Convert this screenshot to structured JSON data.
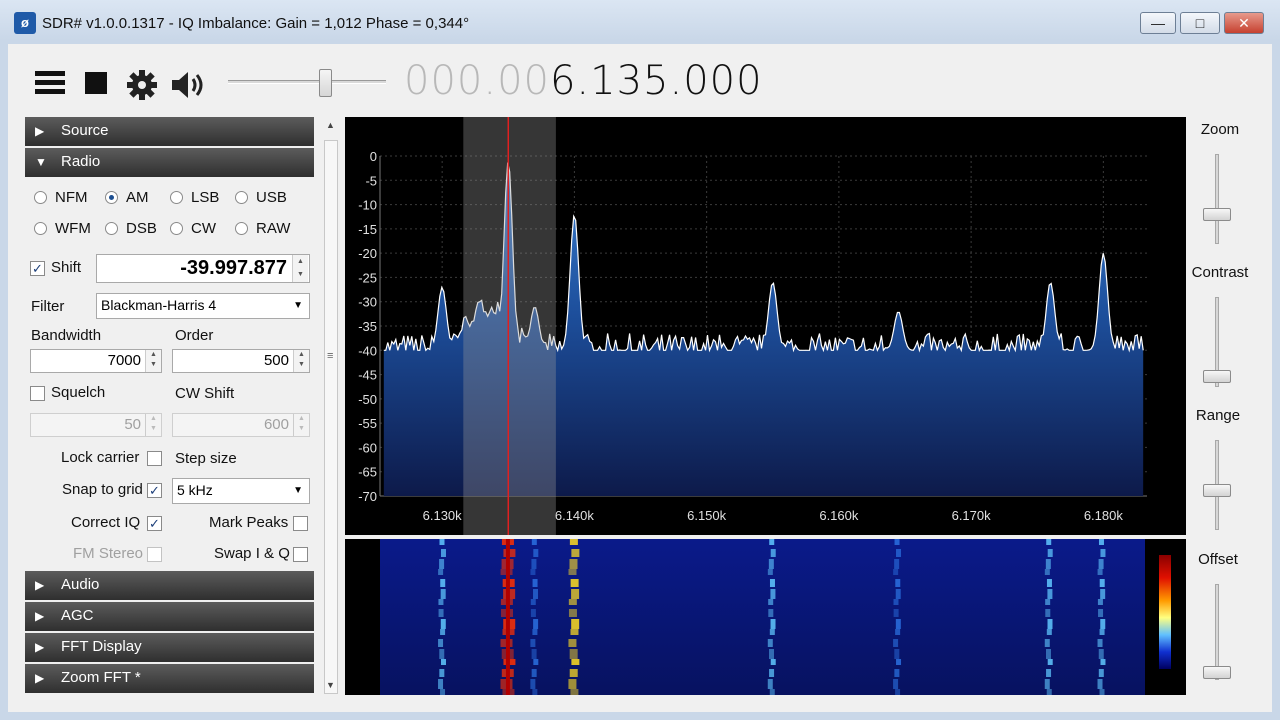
{
  "titlebar": {
    "title": "SDR# v1.0.0.1317 - IQ Imbalance: Gain = 1,012 Phase = 0,344°",
    "minimize": "—",
    "maximize": "□",
    "close": "✕"
  },
  "toolbar": {
    "menu_icon": "hamburger-menu-icon",
    "stop_icon": "stop-icon",
    "settings_icon": "gear-icon",
    "volume_icon": "speaker-icon",
    "volume_level": 0.6,
    "frequency_dim": "000.00",
    "frequency_bright": "6.135.000"
  },
  "sections": {
    "source": "Source",
    "radio": "Radio",
    "audio": "Audio",
    "agc": "AGC",
    "fft_display": "FFT Display",
    "zoom_fft": "Zoom FFT *"
  },
  "radio": {
    "modes": [
      "NFM",
      "AM",
      "LSB",
      "USB",
      "WFM",
      "DSB",
      "CW",
      "RAW"
    ],
    "selected_mode": "AM",
    "shift_label": "Shift",
    "shift_checked": true,
    "shift_value": "-39.997.877",
    "filter_label": "Filter",
    "filter_value": "Blackman-Harris 4",
    "bandwidth_label": "Bandwidth",
    "bandwidth_value": "7000",
    "order_label": "Order",
    "order_value": "500",
    "squelch_label": "Squelch",
    "squelch_value": "50",
    "cw_shift_label": "CW Shift",
    "cw_shift_value": "600",
    "lock_carrier": "Lock carrier",
    "step_size": "Step size",
    "snap_to_grid": "Snap to grid",
    "step_value": "5 kHz",
    "correct_iq": "Correct IQ",
    "mark_peaks": "Mark Peaks",
    "fm_stereo": "FM Stereo",
    "swap_iq": "Swap I & Q"
  },
  "right_controls": {
    "zoom": "Zoom",
    "contrast": "Contrast",
    "range": "Range",
    "offset": "Offset"
  },
  "chart_data": {
    "type": "area",
    "xlabel": "",
    "ylabel": "",
    "y_ticks": [
      "0",
      "-5",
      "-10",
      "-15",
      "-20",
      "-25",
      "-30",
      "-35",
      "-40",
      "-45",
      "-50",
      "-55",
      "-60",
      "-65",
      "-70"
    ],
    "x_ticks": [
      "6.130k",
      "6.140k",
      "6.150k",
      "6.160k",
      "6.170k",
      "6.180k"
    ],
    "ylim": [
      -70,
      0
    ],
    "x_range_khz": [
      6.1253,
      6.1833
    ],
    "tuned_frequency_khz": 6.135,
    "filter_band_khz": [
      6.1316,
      6.1386
    ],
    "peaks": [
      {
        "x": 6.13,
        "y": -27
      },
      {
        "x": 6.135,
        "y": -1
      },
      {
        "x": 6.137,
        "y": -31
      },
      {
        "x": 6.14,
        "y": -12
      },
      {
        "x": 6.155,
        "y": -26
      },
      {
        "x": 6.1645,
        "y": -32
      },
      {
        "x": 6.176,
        "y": -26
      },
      {
        "x": 6.18,
        "y": -20
      }
    ],
    "noise_floor_db": -40,
    "grid": true,
    "colors": {
      "fill_top": "#3a7fd0",
      "fill_bottom": "#0d1a4a",
      "marker": "#e02020",
      "band": "#9a9a9a"
    }
  }
}
